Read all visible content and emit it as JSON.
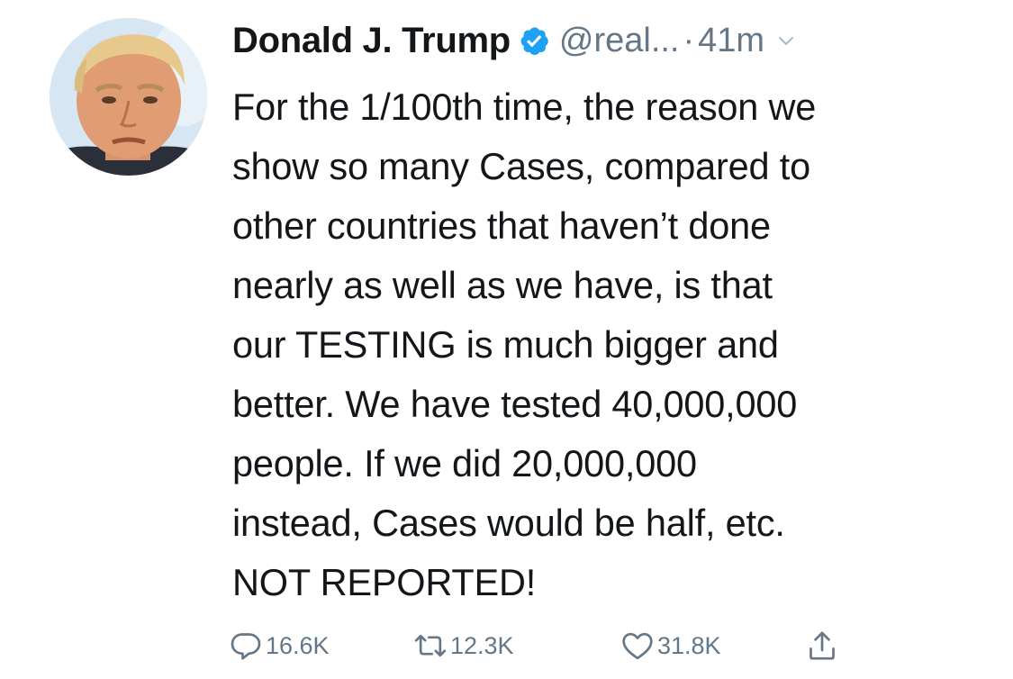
{
  "tweet": {
    "author": {
      "display_name": "Donald J. Trump",
      "handle": "@real...",
      "verified": true,
      "separator": "·",
      "time": "41m"
    },
    "text_lines": [
      "For the 1/100th time, the reason we",
      "show so many Cases, compared to",
      "other countries that haven’t done",
      "nearly as well as we have, is that",
      "our TESTING is much bigger and",
      "better. We have tested 40,000,000",
      "people. If we did 20,000,000",
      "instead, Cases would be half, etc.",
      "NOT REPORTED!"
    ],
    "actions": {
      "replies": "16.6K",
      "retweets": "12.3K",
      "likes": "31.8K"
    }
  },
  "icons": {
    "verified": "verified-badge-icon",
    "menu": "chevron-down-icon",
    "reply": "reply-icon",
    "retweet": "retweet-icon",
    "like": "heart-icon",
    "share": "share-icon"
  },
  "colors": {
    "text": "#14171a",
    "secondary": "#657786",
    "verified": "#1da1f2",
    "background": "#ffffff"
  }
}
